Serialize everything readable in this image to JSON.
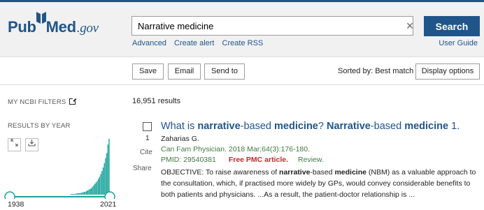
{
  "header": {
    "logo_pub": "Pub",
    "logo_med": "Med",
    "logo_gov": ".gov",
    "search_value": "Narrative medicine",
    "clear_label": "×",
    "search_button": "Search",
    "links": [
      "Advanced",
      "Create alert",
      "Create RSS"
    ],
    "user_guide": "User Guide",
    "brand_color": "#20558a"
  },
  "toolbar": {
    "save": "Save",
    "email": "Email",
    "send_to": "Send to",
    "sorted_by": "Sorted by: Best match",
    "display_options": "Display options"
  },
  "sidebar": {
    "filters_heading": "MY NCBI FILTERS",
    "results_by_year": "RESULTS BY YEAR",
    "expand_icon": "expand-icon",
    "download_icon": "download-icon",
    "year_start": "1938",
    "year_end": "2021",
    "histogram": [
      0,
      0,
      0,
      0,
      0,
      0,
      0,
      0,
      0,
      0,
      0,
      0,
      0,
      0,
      0,
      0,
      0,
      0,
      0,
      0,
      0,
      0,
      0,
      0,
      0,
      0,
      0,
      0,
      0,
      0,
      0,
      0,
      0,
      0,
      0,
      0,
      0,
      0,
      0,
      0,
      0,
      0,
      0,
      0,
      0,
      0,
      0,
      0,
      0,
      0,
      0,
      1,
      1,
      1,
      1,
      1,
      2,
      2,
      2,
      2,
      3,
      3,
      4,
      4,
      5,
      6,
      7,
      8,
      9,
      11,
      13,
      15,
      17,
      19,
      22,
      25,
      29,
      33,
      38,
      44,
      51,
      58,
      70,
      78
    ]
  },
  "results": {
    "count": "16,951 results",
    "items": [
      {
        "number": "1",
        "cite": "Cite",
        "share": "Share",
        "title_parts": [
          "What is ",
          "narrative",
          "-based ",
          "medicine",
          "? ",
          "Narrative",
          "-based ",
          "medicine",
          " 1."
        ],
        "authors": "Zaharias G.",
        "journal": "Can Fam Physician. 2018 Mar;64(3):176-180.",
        "pmid": "PMID: 29540381",
        "pmc": "Free PMC article.",
        "type": "Review.",
        "snippet_parts": [
          "OBJECTIVE: To raise awareness of ",
          "narrative",
          "-based ",
          "medicine",
          " (NBM) as a valuable approach to the consultation, which, if practised more widely by GPs, would convey considerable benefits to both patients and physicians. ...As a result, the patient-doctor relationship is ..."
        ]
      }
    ]
  }
}
